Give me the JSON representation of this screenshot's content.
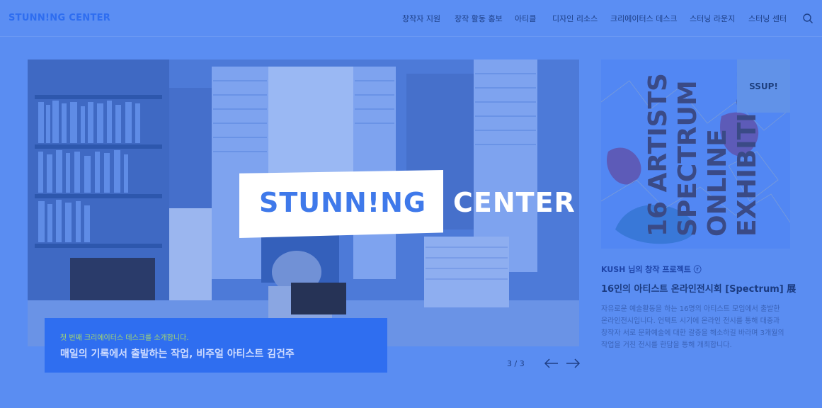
{
  "header": {
    "logo": "STUNN!NG CENTER",
    "nav": [
      {
        "label": "창작자 지원"
      },
      {
        "label": "창작 활동 홍보"
      },
      {
        "label": "아티클"
      },
      {
        "label": "디자인 리소스"
      },
      {
        "label": "크리에이터스 데스크"
      },
      {
        "label": "스터닝 라운지"
      },
      {
        "label": "스터닝 센터"
      }
    ],
    "search_icon": "search-icon"
  },
  "hero": {
    "logo_left": "STUNN!NG",
    "logo_right": "CENTER",
    "caption_sub": "첫 번째 크리에이터스 데스크를 소개합니다.",
    "caption_title": "매일의 기록에서 출발하는 작업, 비주얼 아티스트 김건주",
    "pager": "3 / 3",
    "prev_icon": "arrow-left-icon",
    "next_icon": "arrow-right-icon"
  },
  "feature": {
    "badge": "SSUP!",
    "category": "KUSH 님의 창작 프로젝트 ⓡ",
    "title": "16인의 아티스트 온라인전시회 [Spectrum] 展",
    "desc_lines": [
      "자유로운 예술활동을 하는 16명의 아티스트 모임에서 출발한",
      "온라인전시입니다. 언택트 시기에 온라인 전시를 통해 대중과",
      "창작자 서로 문화예술에 대한 갈증을 해소하길 바라며 3개월의",
      "작업을 거친 전시를 한담을 통해 개최합니다."
    ],
    "poster_text": [
      "16 ARTISTS",
      "SPECTRUM",
      "ONLINE",
      "EXHIBITION"
    ]
  },
  "colors": {
    "background": "#5a8df2",
    "accent": "#2f6ef0",
    "caption_sub": "#a7d96b"
  }
}
